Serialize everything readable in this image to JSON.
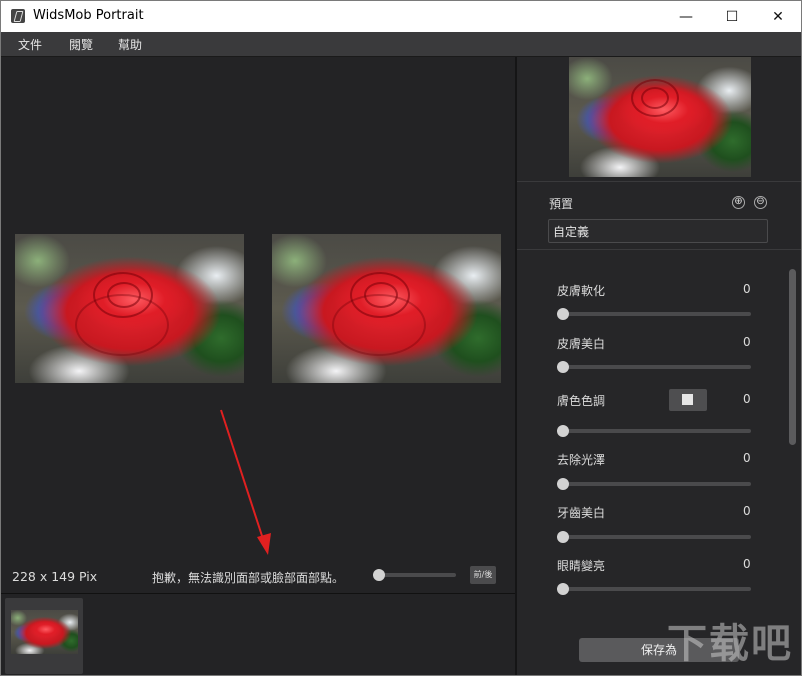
{
  "titlebar": {
    "title": "WidsMob Portrait",
    "minimize": "—",
    "maximize": "☐",
    "close": "✕"
  },
  "menu": {
    "items": [
      "文件",
      "閱覽",
      "幫助"
    ]
  },
  "canvas": {
    "dimensions": "228 x 149 Pix",
    "message": "抱歉，無法識別面部或臉部面部點。",
    "compare_button": "前/後",
    "zoom_fraction": 0.0
  },
  "preset": {
    "label": "預置",
    "add_icon": "⊕",
    "remove_icon": "⊖",
    "value": "自定義"
  },
  "adjustments": [
    {
      "label": "皮膚軟化",
      "value": "0",
      "fraction": 0.0
    },
    {
      "label": "皮膚美白",
      "value": "0",
      "fraction": 0.0
    },
    {
      "label": "膚色色調",
      "value": "0",
      "fraction": 0.0
    },
    {
      "label": "去除光澤",
      "value": "0",
      "fraction": 0.0
    },
    {
      "label": "牙齒美白",
      "value": "0",
      "fraction": 0.0
    },
    {
      "label": "眼睛變亮",
      "value": "0",
      "fraction": 0.0
    }
  ],
  "save_button": "保存為",
  "watermark": "下载吧",
  "colors": {
    "annotation_arrow": "#e02020",
    "panel_bg": "#262628",
    "canvas_bg": "#232325"
  }
}
